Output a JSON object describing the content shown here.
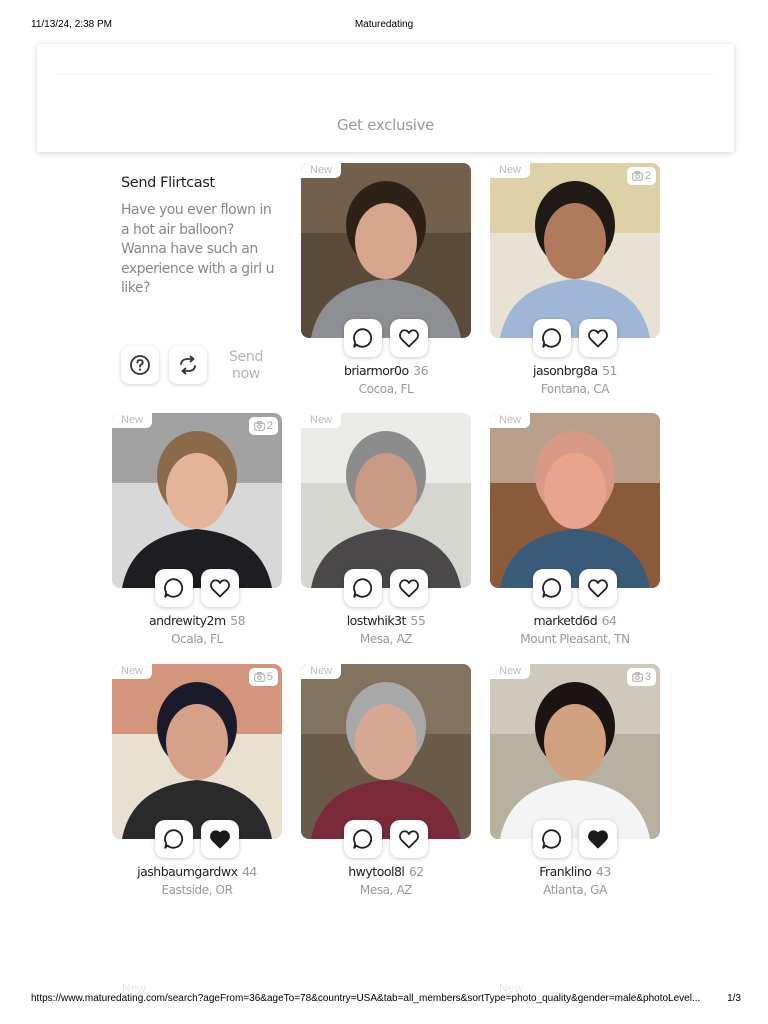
{
  "print_header": {
    "datetime": "11/13/24, 2:38 PM",
    "page_title": "Maturedating"
  },
  "banner": {
    "cta_text": "Get exclusive"
  },
  "flirtcast": {
    "title": "Send Flirtcast",
    "message": "Have you ever flown in a hot air balloon? Wanna have such an experience with a girl u like?",
    "send_label_line1": "Send",
    "send_label_line2": "now"
  },
  "new_label": "New",
  "profiles": [
    {
      "username": "briarmor0o",
      "age": "36",
      "location": "Cocoa, FL",
      "photos": "",
      "liked": false
    },
    {
      "username": "jasonbrg8a",
      "age": "51",
      "location": "Fontana, CA",
      "photos": "2",
      "liked": false
    },
    {
      "username": "andrewity2m",
      "age": "58",
      "location": "Ocala, FL",
      "photos": "2",
      "liked": false
    },
    {
      "username": "lostwhik3t",
      "age": "55",
      "location": "Mesa, AZ",
      "photos": "",
      "liked": false
    },
    {
      "username": "marketd6d",
      "age": "64",
      "location": "Mount Pleasant, TN",
      "photos": "",
      "liked": false
    },
    {
      "username": "jashbaumgardwx",
      "age": "44",
      "location": "Eastside, OR",
      "photos": "5",
      "liked": true
    },
    {
      "username": "hwytool8l",
      "age": "62",
      "location": "Mesa, AZ",
      "photos": "",
      "liked": false
    },
    {
      "username": "Franklino",
      "age": "43",
      "location": "Atlanta, GA",
      "photos": "3",
      "liked": true
    }
  ],
  "print_footer": {
    "url": "https://www.maturedating.com/search?ageFrom=36&ageTo=78&country=USA&tab=all_members&sortType=photo_quality&gender=male&photoLevel...",
    "page": "1/3"
  },
  "icons": {
    "help": "help-icon",
    "refresh": "refresh-icon",
    "chat": "chat-bubble-icon",
    "like": "heart-icon",
    "camera": "camera-icon"
  }
}
